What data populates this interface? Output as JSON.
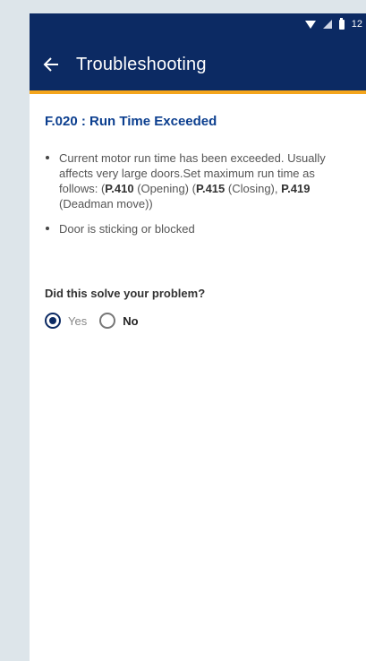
{
  "status_bar": {
    "time": "12"
  },
  "header": {
    "title": "Troubleshooting",
    "back_icon": "arrow-left-icon"
  },
  "fault": {
    "title": "F.020 : Run Time Exceeded"
  },
  "bullets": [
    {
      "text_1": "Current motor run time has been exceeded. Usually affects very large doors.Set maximum run time as follows: (",
      "code_1": "P.410",
      "text_2": " (Opening) (",
      "code_2": "P.415",
      "text_3": " (Closing), ",
      "code_3": "P.419",
      "text_4": " (Deadman move))"
    },
    {
      "text": "Door is sticking or blocked"
    }
  ],
  "feedback": {
    "question": "Did this solve your problem?",
    "options": [
      {
        "label": "Yes",
        "selected": true
      },
      {
        "label": "No",
        "selected": false
      }
    ]
  },
  "colors": {
    "primary": "#0c2a63",
    "accent": "#f4a51c",
    "title_blue": "#0c3f8f"
  }
}
